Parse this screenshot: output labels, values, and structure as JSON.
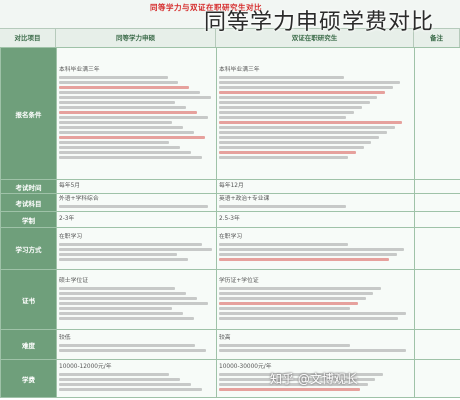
{
  "overlay_title": "同等学力申硕学费对比",
  "document": {
    "title": "同等学力与双证在职研究生对比",
    "header": [
      "对比项目",
      "同等学力申硕",
      "双证在职研究生",
      "备注"
    ]
  },
  "rows": [
    {
      "label": "报名条件",
      "col_a": "本科毕业满三年",
      "col_b": "本科毕业满三年",
      "col_c": ""
    },
    {
      "label": "考试时间",
      "col_a": "每年5月",
      "col_b": "每年12月",
      "col_c": ""
    },
    {
      "label": "考试科目",
      "col_a": "外语+学科综合",
      "col_b": "英语+政治+专业课",
      "col_c": ""
    },
    {
      "label": "学制",
      "col_a": "2-3年",
      "col_b": "2.5-3年",
      "col_c": ""
    },
    {
      "label": "学习方式",
      "col_a": "在职学习",
      "col_b": "在职学习",
      "col_c": ""
    },
    {
      "label": "证书",
      "col_a": "硕士学位证",
      "col_b": "学历证+学位证",
      "col_c": ""
    },
    {
      "label": "难度",
      "col_a": "较低",
      "col_b": "较高",
      "col_c": ""
    },
    {
      "label": "学费",
      "col_a": "10000-12000元/年",
      "col_b": "10000-30000元/年",
      "col_c": ""
    }
  ],
  "watermark": "知乎 @文博观长"
}
